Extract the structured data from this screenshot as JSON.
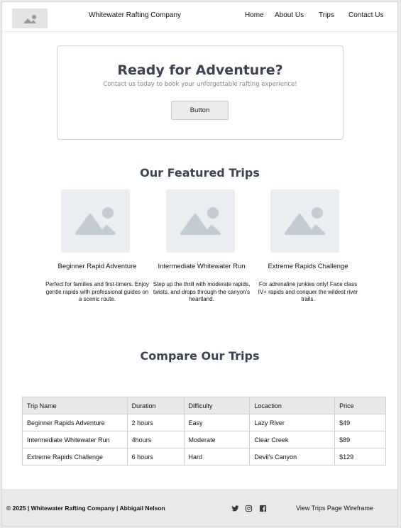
{
  "header": {
    "logo_icon": "image-placeholder-icon",
    "brand": "Whitewater Rafting Company",
    "nav": [
      "Home",
      "About Us",
      "Trips",
      "Contact Us"
    ]
  },
  "hero": {
    "title": "Ready for Adventure?",
    "subtitle": "Contact us today to book your unforgettable rafting experience!",
    "button": "Button"
  },
  "featured": {
    "title": "Our Featured Trips",
    "cards": [
      {
        "image_icon": "image-placeholder-icon",
        "title": "Beginner Rapid Adventure",
        "description": "Perfect for families and first-timers. Enjoy gentle rapids with professional guides on a scenic route."
      },
      {
        "image_icon": "image-placeholder-icon",
        "title": "Intermediate Whitewater Run",
        "description": "Step up the thrill with moderate rapids, twists, and drops through the canyon's heartland."
      },
      {
        "image_icon": "image-placeholder-icon",
        "title": "Extreme Rapids Challenge",
        "description": "For adrenaline junkies only! Face class IV+ rapids and conquer the wildest river trails."
      }
    ]
  },
  "compare": {
    "title": "Compare Our Trips",
    "columns": [
      "Trip Name",
      "Duration",
      "Difficulty",
      "Locaction",
      "Price"
    ],
    "rows": [
      [
        "Beginner Rapids Adventure",
        "2 hours",
        "Easy",
        "Lazy River",
        "$49"
      ],
      [
        "Intermediate Whitewater Run",
        "4hours",
        "Moderate",
        "Clear Creek",
        "$89"
      ],
      [
        "Extreme Rapids Challenge",
        "6 hours",
        "Hard",
        "Devil's Canyon",
        "$129"
      ]
    ]
  },
  "footer": {
    "copyright": "© 2025 | Whitewater Rafting Company | Abbigail Nelson",
    "social_icons": [
      "twitter-icon",
      "instagram-icon",
      "facebook-icon"
    ],
    "link": "View Trips Page Wireframe"
  },
  "colors": {
    "heading": "#3b4454",
    "placeholder_bg": "#eaedf1",
    "placeholder_fg": "#c3cbd4",
    "footer_bg": "#e9e9ea"
  }
}
